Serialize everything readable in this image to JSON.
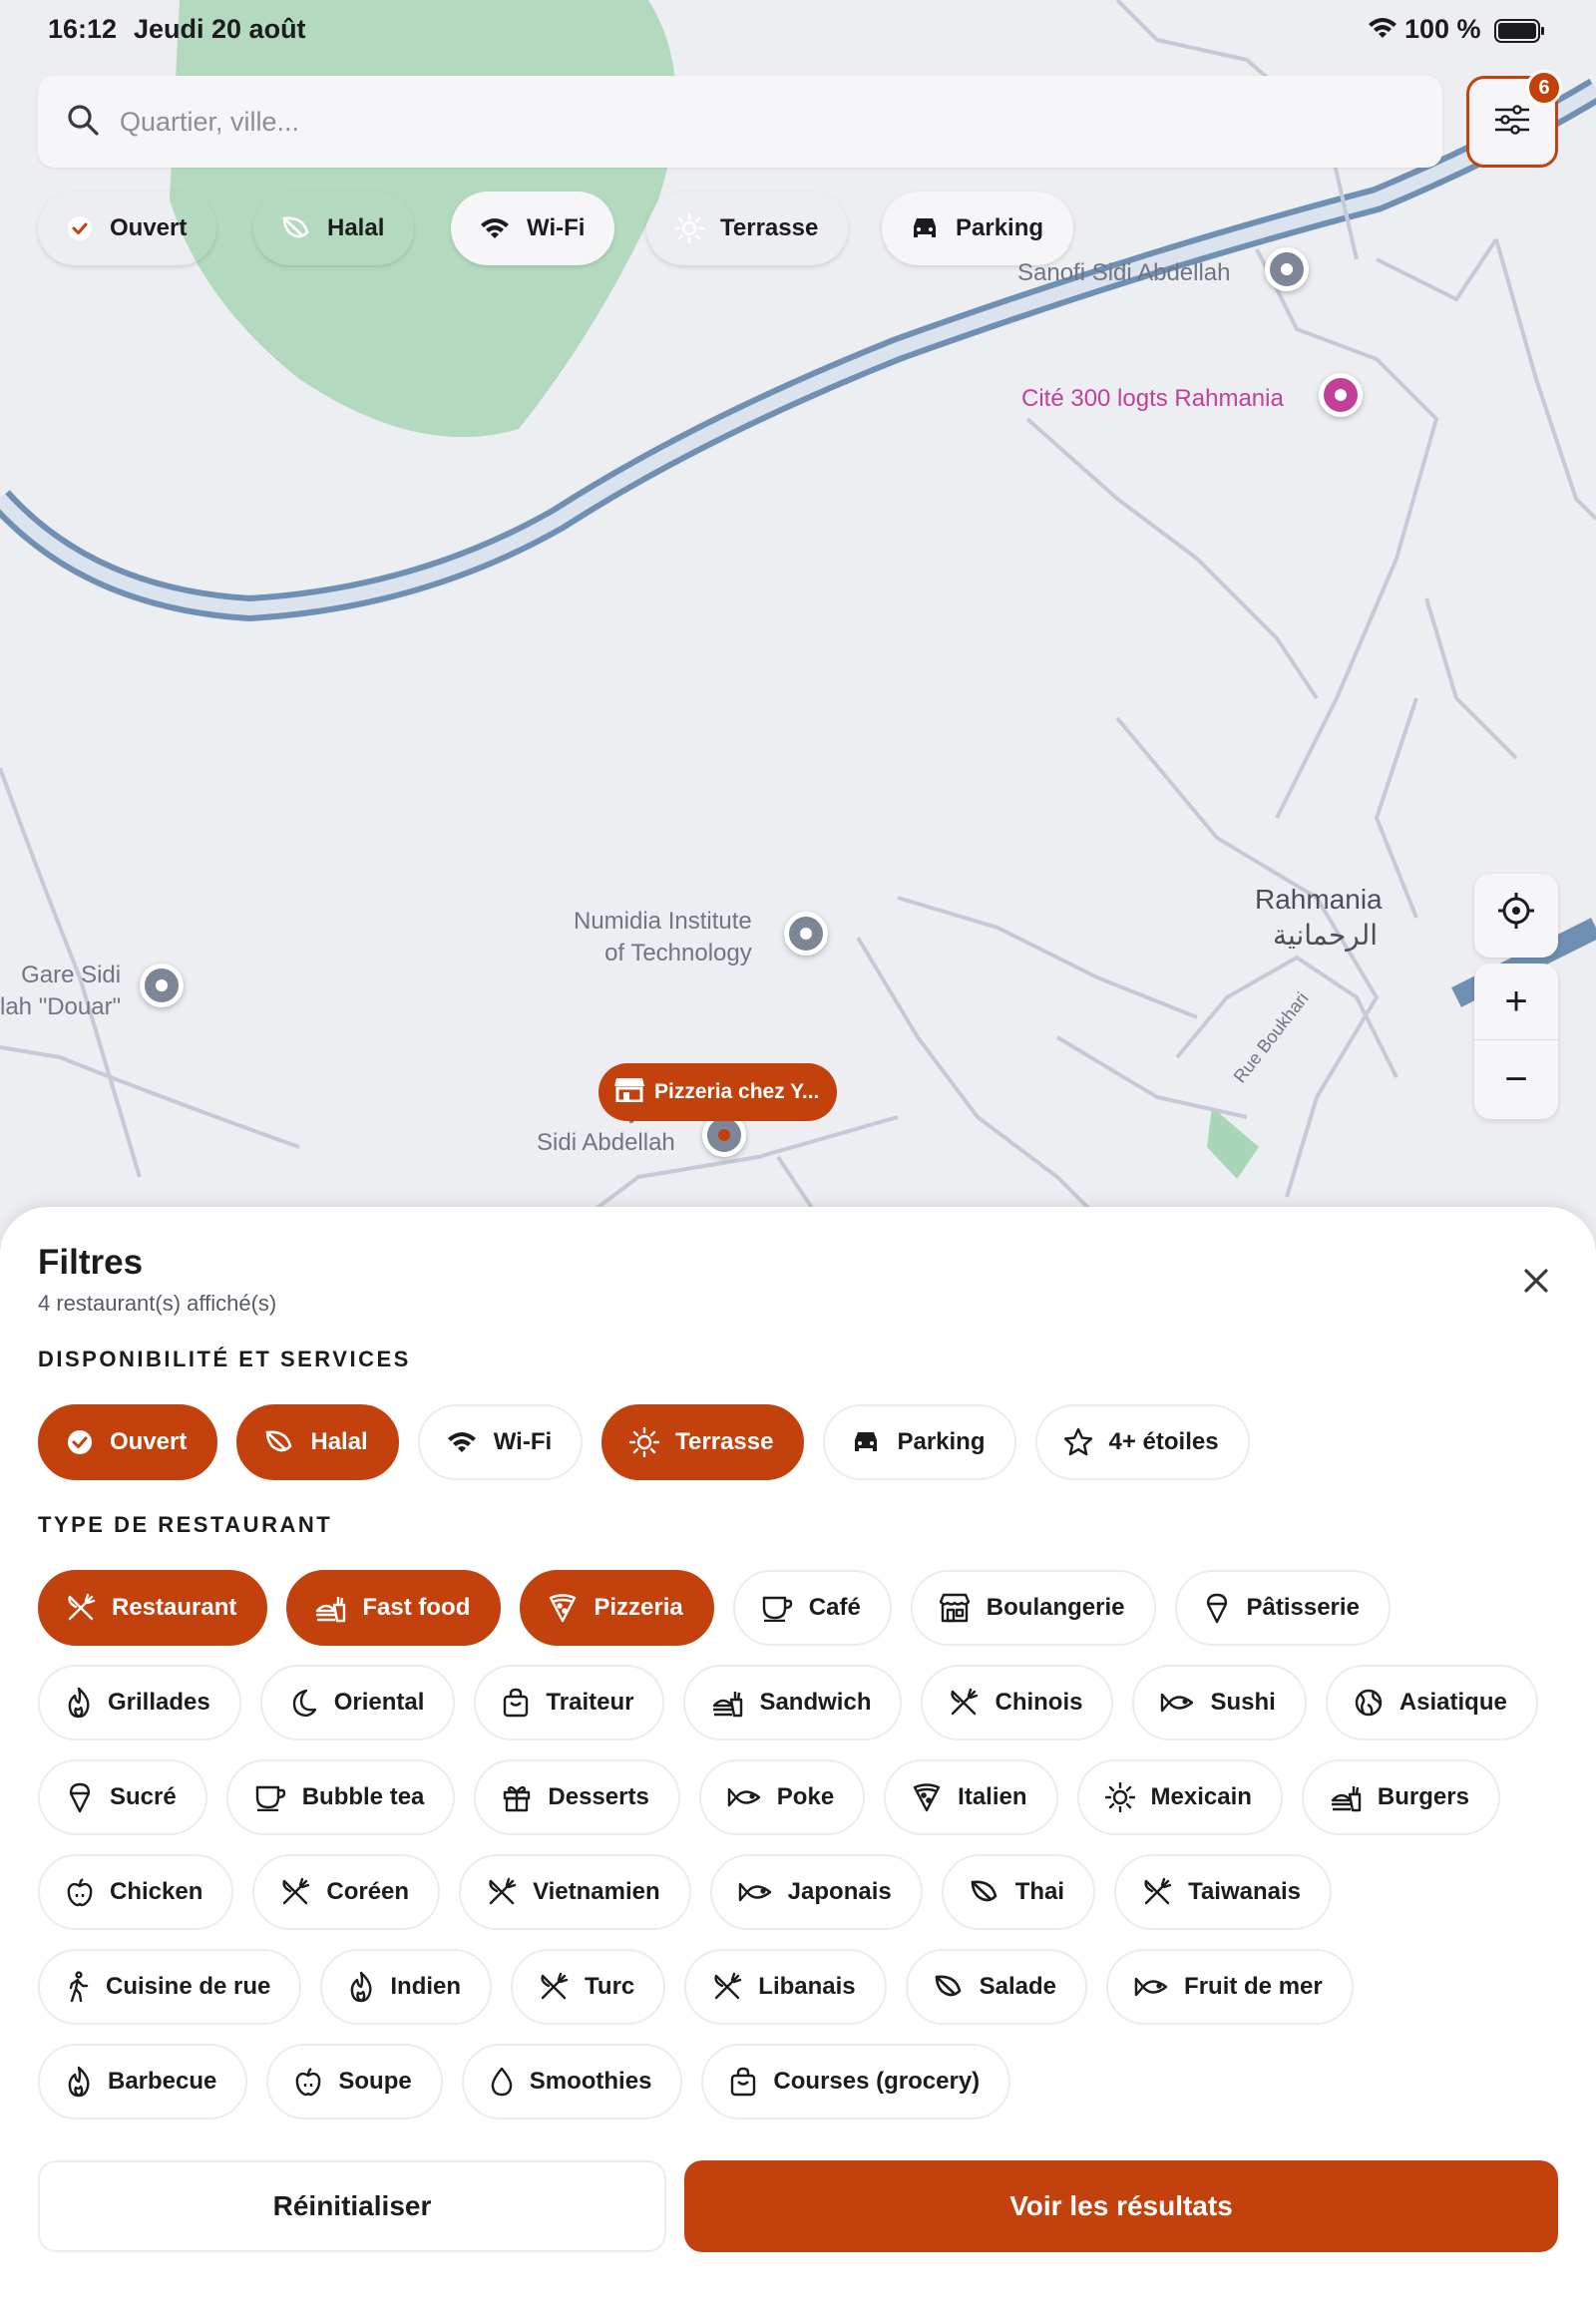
{
  "status_bar": {
    "time": "16:12",
    "date": "Jeudi 20 août",
    "battery": "100 %"
  },
  "search": {
    "placeholder": "Quartier, ville..."
  },
  "filter_button": {
    "badge": "6",
    "icon": "sliders-icon"
  },
  "map_chips": [
    {
      "label": "Ouvert",
      "active": true,
      "icon": "check-circle-icon"
    },
    {
      "label": "Halal",
      "active": true,
      "icon": "leaf-icon"
    },
    {
      "label": "Wi-Fi",
      "active": false,
      "icon": "wifi-icon"
    },
    {
      "label": "Terrasse",
      "active": true,
      "icon": "sun-icon"
    },
    {
      "label": "Parking",
      "active": false,
      "icon": "car-icon"
    }
  ],
  "map": {
    "labels": {
      "sanofi": "Sanofi Sidi Abdellah",
      "cite": "Cité 300 logts Rahmania",
      "rahmania": "Rahmania",
      "rahmania_ar": "الرحمانية",
      "numidia": "Numidia Institute\nof Technology",
      "gare": "Gare Sidi\nlah \"Douar\"",
      "cyber": "Cyber\nSidi Abdellah",
      "street": "Rue Boukhari"
    },
    "pizzeria_marker": "Pizzeria chez Y...",
    "controls": {
      "zoom_in": "+",
      "zoom_out": "−"
    }
  },
  "sheet": {
    "title": "Filtres",
    "subtitle": "4 restaurant(s) affiché(s)",
    "section_services": "DISPONIBILITÉ ET SERVICES",
    "services": [
      {
        "label": "Ouvert",
        "active": true,
        "icon": "check-circle-icon"
      },
      {
        "label": "Halal",
        "active": true,
        "icon": "leaf-icon"
      },
      {
        "label": "Wi-Fi",
        "active": false,
        "icon": "wifi-icon"
      },
      {
        "label": "Terrasse",
        "active": true,
        "icon": "sun-icon"
      },
      {
        "label": "Parking",
        "active": false,
        "icon": "car-icon"
      },
      {
        "label": "4+ étoiles",
        "active": false,
        "icon": "star-icon"
      }
    ],
    "section_types": "TYPE DE RESTAURANT",
    "type_rows": [
      [
        {
          "label": "Restaurant",
          "active": true,
          "icon": "utensils-icon"
        },
        {
          "label": "Fast food",
          "active": true,
          "icon": "burger-fries-icon"
        },
        {
          "label": "Pizzeria",
          "active": true,
          "icon": "pizza-icon"
        },
        {
          "label": "Café",
          "active": false,
          "icon": "cup-icon"
        },
        {
          "label": "Boulangerie",
          "active": false,
          "icon": "store-icon"
        },
        {
          "label": "Pâtisserie",
          "active": false,
          "icon": "ice-cream-icon"
        }
      ],
      [
        {
          "label": "Grillades",
          "active": false,
          "icon": "flame-icon"
        },
        {
          "label": "Oriental",
          "active": false,
          "icon": "moon-icon"
        },
        {
          "label": "Traiteur",
          "active": false,
          "icon": "bag-icon"
        },
        {
          "label": "Sandwich",
          "active": false,
          "icon": "burger-fries-icon"
        },
        {
          "label": "Chinois",
          "active": false,
          "icon": "utensils-icon"
        },
        {
          "label": "Sushi",
          "active": false,
          "icon": "fish-icon"
        },
        {
          "label": "Asiatique",
          "active": false,
          "icon": "globe-icon"
        }
      ],
      [
        {
          "label": "Sucré",
          "active": false,
          "icon": "ice-cream-icon"
        },
        {
          "label": "Bubble tea",
          "active": false,
          "icon": "cup-icon"
        },
        {
          "label": "Desserts",
          "active": false,
          "icon": "gift-icon"
        },
        {
          "label": "Poke",
          "active": false,
          "icon": "fish-icon"
        },
        {
          "label": "Italien",
          "active": false,
          "icon": "pizza-icon"
        },
        {
          "label": "Mexicain",
          "active": false,
          "icon": "sun-icon"
        },
        {
          "label": "Burgers",
          "active": false,
          "icon": "burger-fries-icon"
        }
      ],
      [
        {
          "label": "Chicken",
          "active": false,
          "icon": "apple-icon"
        },
        {
          "label": "Coréen",
          "active": false,
          "icon": "utensils-icon"
        },
        {
          "label": "Vietnamien",
          "active": false,
          "icon": "utensils-icon"
        },
        {
          "label": "Japonais",
          "active": false,
          "icon": "fish-icon"
        },
        {
          "label": "Thai",
          "active": false,
          "icon": "leaf-icon"
        },
        {
          "label": "Taiwanais",
          "active": false,
          "icon": "utensils-icon"
        }
      ],
      [
        {
          "label": "Cuisine de rue",
          "active": false,
          "icon": "walking-icon"
        },
        {
          "label": "Indien",
          "active": false,
          "icon": "flame-icon"
        },
        {
          "label": "Turc",
          "active": false,
          "icon": "utensils-icon"
        },
        {
          "label": "Libanais",
          "active": false,
          "icon": "utensils-icon"
        },
        {
          "label": "Salade",
          "active": false,
          "icon": "leaf-icon"
        },
        {
          "label": "Fruit de mer",
          "active": false,
          "icon": "fish-icon"
        }
      ],
      [
        {
          "label": "Barbecue",
          "active": false,
          "icon": "flame-icon"
        },
        {
          "label": "Soupe",
          "active": false,
          "icon": "apple-icon"
        },
        {
          "label": "Smoothies",
          "active": false,
          "icon": "drop-icon"
        },
        {
          "label": "Courses (grocery)",
          "active": false,
          "icon": "bag-icon"
        }
      ]
    ],
    "reset_label": "Réinitialiser",
    "submit_label": "Voir les résultats"
  },
  "colors": {
    "accent": "#c2410c",
    "chip_border": "#ececef",
    "map_bg": "#eceef1",
    "road": "#6f8fb3"
  }
}
